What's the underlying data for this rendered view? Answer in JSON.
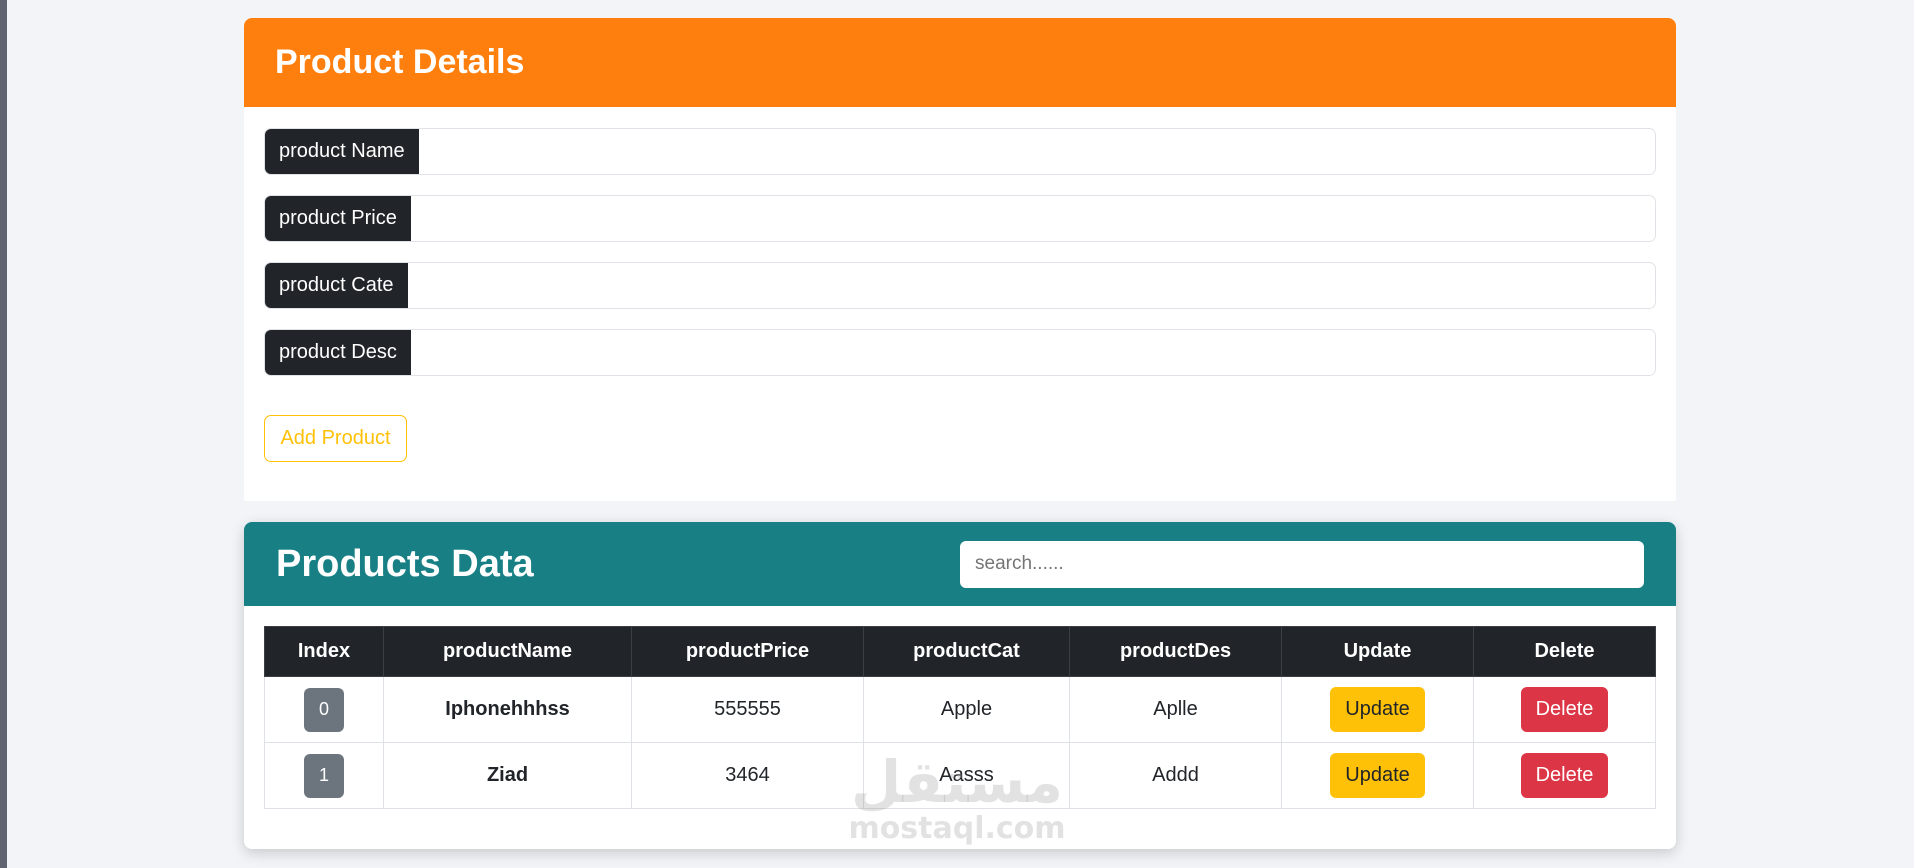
{
  "details": {
    "title": "Product Details",
    "fields": [
      {
        "label": "product Name",
        "value": ""
      },
      {
        "label": "product Price",
        "value": ""
      },
      {
        "label": "product Cate",
        "value": ""
      },
      {
        "label": "product Desc",
        "value": ""
      }
    ],
    "add_button": "Add Product"
  },
  "data": {
    "title": "Products Data",
    "search_placeholder": "search......",
    "columns": [
      "Index",
      "productName",
      "productPrice",
      "productCat",
      "productDes",
      "Update",
      "Delete"
    ],
    "rows": [
      {
        "index": "0",
        "name": "Iphonehhhss",
        "price": "555555",
        "cat": "Apple",
        "desc": "Aplle",
        "update": "Update",
        "delete": "Delete"
      },
      {
        "index": "1",
        "name": "Ziad",
        "price": "3464",
        "cat": "Aasss",
        "desc": "Addd",
        "update": "Update",
        "delete": "Delete"
      }
    ]
  },
  "watermark": {
    "arabic": "مستقل",
    "latin": "mostaql.com"
  },
  "colors": {
    "details_header": "#ff7f0e",
    "data_header": "#188085",
    "update_button": "#ffc107",
    "delete_button": "#dc3545",
    "index_badge": "#6c757d"
  }
}
